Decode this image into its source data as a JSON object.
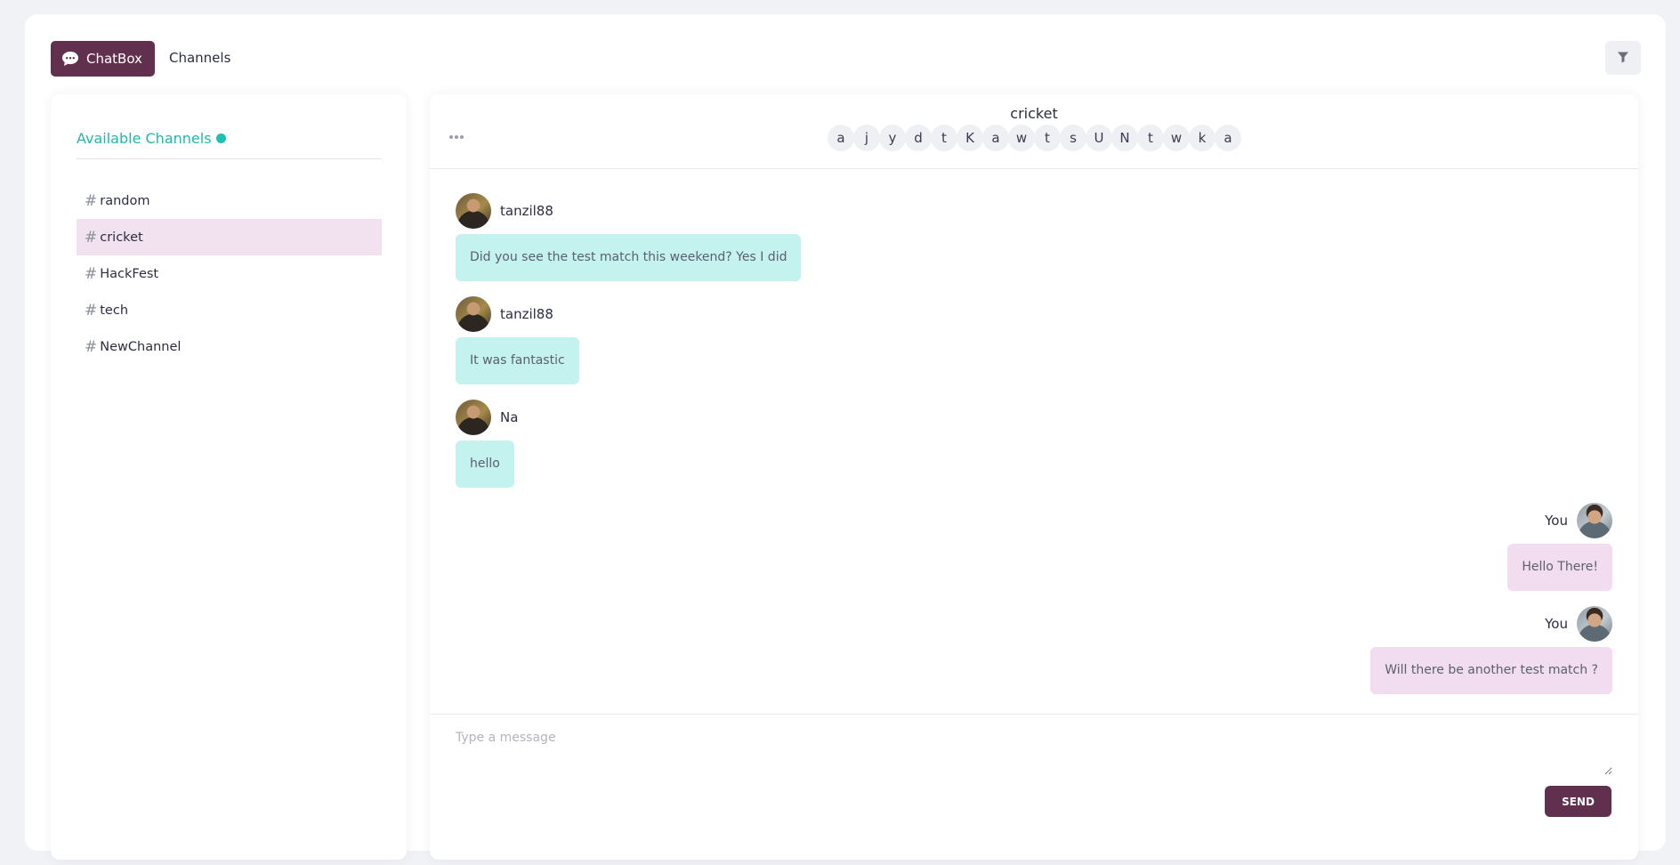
{
  "nav": {
    "brand_label": "ChatBox",
    "channels_link": "Channels"
  },
  "icons": {
    "brand": "chat-bubble-icon",
    "filter": "filter-icon",
    "more": "more-horizontal-icon",
    "channel_prefix": "hash-icon"
  },
  "colors": {
    "brand": "#62304f",
    "accent_teal": "#1fb8ad",
    "incoming_bubble": "#c4f2ef",
    "outgoing_bubble": "#f1ddef",
    "active_channel": "#f2e1ef"
  },
  "sidebar": {
    "title": "Available Channels",
    "items": [
      {
        "label": "random",
        "active": false
      },
      {
        "label": "cricket",
        "active": true
      },
      {
        "label": "HackFest",
        "active": false
      },
      {
        "label": "tech",
        "active": false
      },
      {
        "label": "NewChannel",
        "active": false
      }
    ]
  },
  "chat": {
    "channel_name": "cricket",
    "members": [
      "a",
      "j",
      "y",
      "d",
      "t",
      "K",
      "a",
      "w",
      "t",
      "s",
      "U",
      "N",
      "t",
      "w",
      "k",
      "a"
    ],
    "messages": [
      {
        "author": "tanzil88",
        "text": "Did you see the test match this weekend? Yes I did",
        "self": false
      },
      {
        "author": "tanzil88",
        "text": "It was fantastic",
        "self": false
      },
      {
        "author": "Na",
        "text": "hello",
        "self": false
      },
      {
        "author": "You",
        "text": "Hello There!",
        "self": true
      },
      {
        "author": "You",
        "text": "Will there be another test match ?",
        "self": true
      }
    ]
  },
  "composer": {
    "placeholder": "Type a message",
    "value": "",
    "send_label": "SEND"
  }
}
